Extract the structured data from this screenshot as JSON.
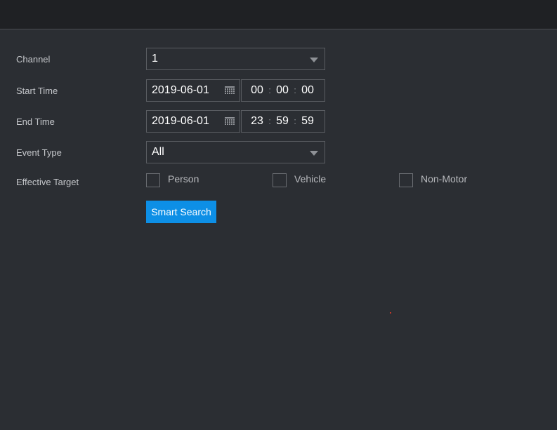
{
  "form": {
    "channel": {
      "label": "Channel",
      "value": "1"
    },
    "start_time": {
      "label": "Start Time",
      "date": "2019-06-01",
      "hh": "00",
      "mm": "00",
      "ss": "00"
    },
    "end_time": {
      "label": "End Time",
      "date": "2019-06-01",
      "hh": "23",
      "mm": "59",
      "ss": "59"
    },
    "event_type": {
      "label": "Event Type",
      "value": "All"
    },
    "effective_target": {
      "label": "Effective Target",
      "options": [
        {
          "label": "Person",
          "checked": false
        },
        {
          "label": "Vehicle",
          "checked": false
        },
        {
          "label": "Non-Motor",
          "checked": false
        }
      ]
    },
    "time_separator": ":",
    "search_button": "Smart Search"
  },
  "colors": {
    "background": "#2b2e33",
    "topbar": "#1f2124",
    "accent": "#0d8fe6"
  },
  "icons": [
    "calendar-icon",
    "chevron-down-icon"
  ]
}
